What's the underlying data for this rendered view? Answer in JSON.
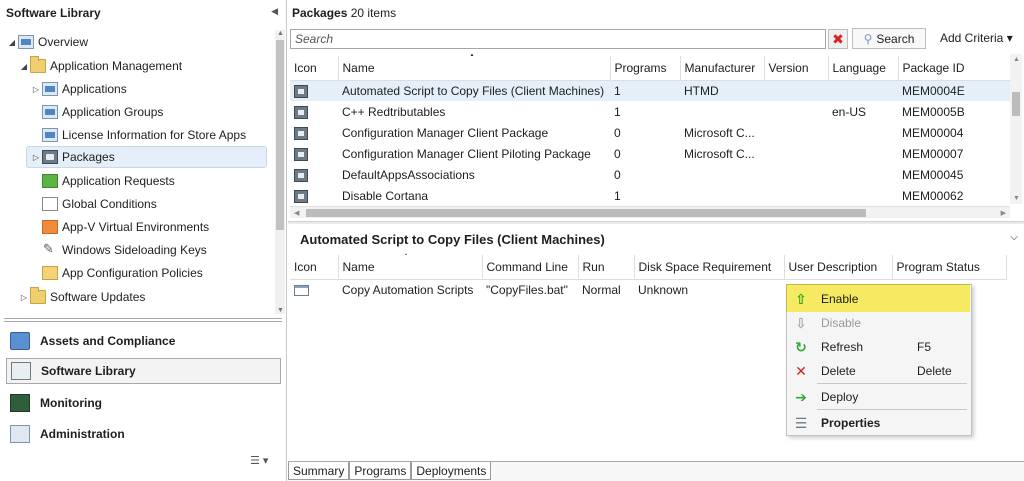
{
  "nav": {
    "title": "Software Library",
    "collapse_glyph": "◀",
    "tree": [
      {
        "label": "Overview",
        "level": 0,
        "expander": "◢",
        "icon": "overview-icon"
      },
      {
        "label": "Application Management",
        "level": 1,
        "expander": "◢",
        "icon": "folder-icon"
      },
      {
        "label": "Applications",
        "level": 2,
        "expander": "▷",
        "icon": "applications-icon"
      },
      {
        "label": "Application Groups",
        "level": 2,
        "expander": "",
        "icon": "application-groups-icon"
      },
      {
        "label": "License Information for Store Apps",
        "level": 2,
        "expander": "",
        "icon": "license-icon"
      },
      {
        "label": "Packages",
        "level": 2,
        "expander": "▷",
        "icon": "packages-icon",
        "selected": true
      },
      {
        "label": "Application Requests",
        "level": 2,
        "expander": "",
        "icon": "application-requests-icon"
      },
      {
        "label": "Global Conditions",
        "level": 2,
        "expander": "",
        "icon": "global-conditions-icon"
      },
      {
        "label": "App-V Virtual Environments",
        "level": 2,
        "expander": "",
        "icon": "appv-icon"
      },
      {
        "label": "Windows Sideloading Keys",
        "level": 2,
        "expander": "",
        "icon": "sideloading-keys-icon"
      },
      {
        "label": "App Configuration Policies",
        "level": 2,
        "expander": "",
        "icon": "app-config-icon"
      },
      {
        "label": "Software Updates",
        "level": 1,
        "expander": "▷",
        "icon": "folder-icon"
      }
    ],
    "workspaces": [
      {
        "label": "Assets and Compliance",
        "icon": "assets-compliance-icon"
      },
      {
        "label": "Software Library",
        "icon": "software-library-icon",
        "active": true
      },
      {
        "label": "Monitoring",
        "icon": "monitoring-icon"
      },
      {
        "label": "Administration",
        "icon": "administration-icon"
      }
    ],
    "bottom_tools_glyph": "☰ ▾"
  },
  "packages": {
    "header_title": "Packages",
    "header_count": "20 items",
    "search_placeholder": "Search",
    "search_button": "Search",
    "add_criteria": "Add Criteria ▾",
    "columns": [
      "Icon",
      "Name",
      "Programs",
      "Manufacturer",
      "Version",
      "Language",
      "Package ID"
    ],
    "rows": [
      {
        "name": "Automated Script to Copy Files (Client Machines)",
        "programs": "1",
        "manufacturer": "HTMD",
        "version": "",
        "language": "",
        "package_id": "MEM0004E",
        "selected": true
      },
      {
        "name": "C++ Redtributables",
        "programs": "1",
        "manufacturer": "",
        "version": "",
        "language": "en-US",
        "package_id": "MEM0005B"
      },
      {
        "name": "Configuration Manager Client Package",
        "programs": "0",
        "manufacturer": "Microsoft C...",
        "version": "",
        "language": "",
        "package_id": "MEM00004"
      },
      {
        "name": "Configuration Manager Client Piloting Package",
        "programs": "0",
        "manufacturer": "Microsoft C...",
        "version": "",
        "language": "",
        "package_id": "MEM00007"
      },
      {
        "name": "DefaultAppsAssociations",
        "programs": "0",
        "manufacturer": "",
        "version": "",
        "language": "",
        "package_id": "MEM00045"
      },
      {
        "name": "Disable Cortana",
        "programs": "1",
        "manufacturer": "",
        "version": "",
        "language": "",
        "package_id": "MEM00062"
      }
    ]
  },
  "detail": {
    "title": "Automated Script to Copy Files (Client Machines)",
    "columns": [
      "Icon",
      "Name",
      "Command Line",
      "Run",
      "Disk Space Requirement",
      "User Description",
      "Program Status"
    ],
    "rows": [
      {
        "name": "Copy Automation Scripts",
        "command_line": "\"CopyFiles.bat\"",
        "run": "Normal",
        "disk_space": "Unknown",
        "user_description": "",
        "program_status": ""
      }
    ],
    "tabs": [
      "Summary",
      "Programs",
      "Deployments"
    ],
    "active_tab": "Programs"
  },
  "context_menu": {
    "items": [
      {
        "label": "Enable",
        "shortcut": "",
        "icon": "enable-icon",
        "glyph": "⇧",
        "color": "#2fa836",
        "highlighted": true
      },
      {
        "label": "Disable",
        "shortcut": "",
        "icon": "disable-icon",
        "glyph": "⇩",
        "color": "#a8a8a8",
        "disabled": true
      },
      {
        "label": "Refresh",
        "shortcut": "F5",
        "icon": "refresh-icon",
        "glyph": "↻",
        "color": "#2fa836"
      },
      {
        "label": "Delete",
        "shortcut": "Delete",
        "icon": "delete-icon",
        "glyph": "✕",
        "color": "#d62020"
      },
      {
        "label": "Deploy",
        "shortcut": "",
        "icon": "deploy-icon",
        "glyph": "➔",
        "color": "#2fa836"
      },
      {
        "label": "Properties",
        "shortcut": "",
        "icon": "properties-icon",
        "glyph": "☰",
        "color": "#6d7b86",
        "bold": true
      }
    ],
    "highlight_color": "#fff34a"
  }
}
